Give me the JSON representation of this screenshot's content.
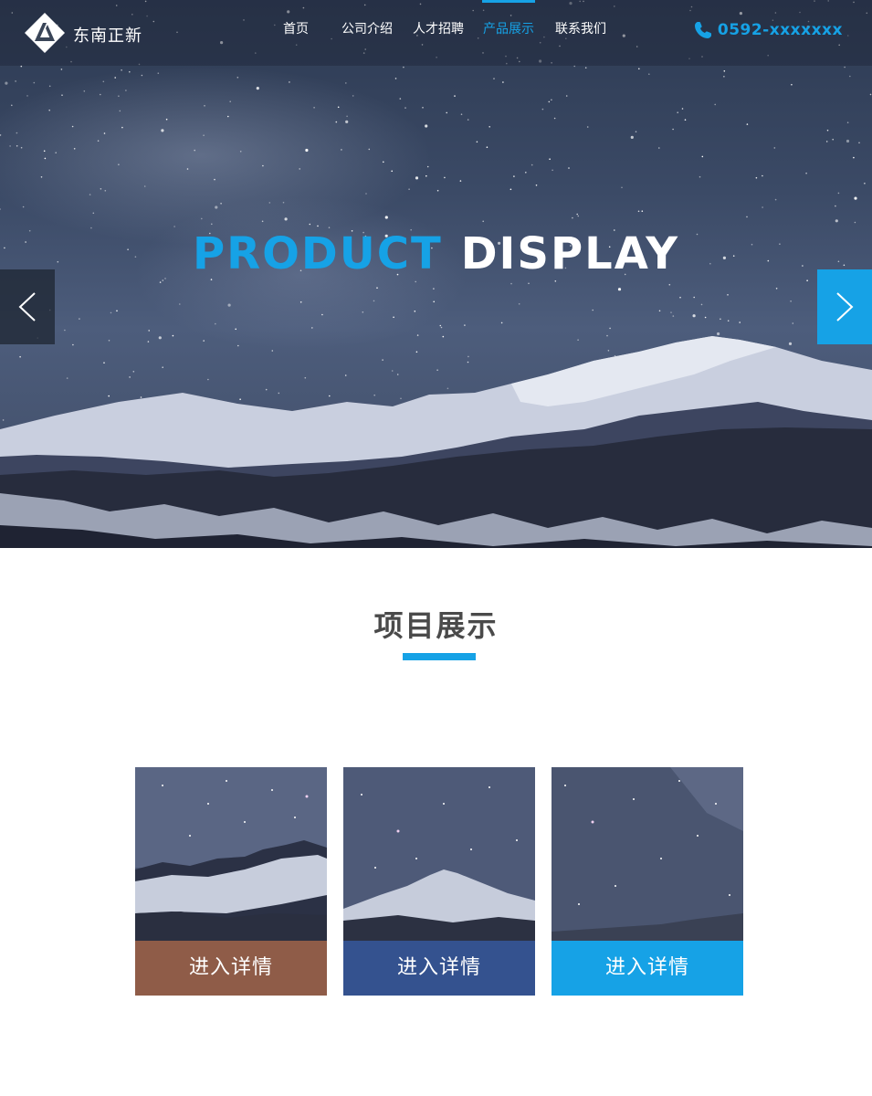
{
  "header": {
    "logo_text": "东南正新",
    "nav": [
      {
        "label": "首页"
      },
      {
        "label": "公司介绍"
      },
      {
        "label": "人才招聘"
      },
      {
        "label": "产品展示",
        "active": true
      },
      {
        "label": "联系我们"
      }
    ],
    "phone": "0592-xxxxxxx",
    "phone_icon": "phone-icon"
  },
  "hero": {
    "title_part1": "PRODUCT",
    "title_part2": "DISPLAY",
    "prev_icon": "chevron-left-icon",
    "next_icon": "chevron-right-icon"
  },
  "section": {
    "title": "项目展示"
  },
  "cards": [
    {
      "button_label": "进入详情",
      "color": "#8f5c48"
    },
    {
      "button_label": "进入详情",
      "color": "#34528f"
    },
    {
      "button_label": "进入详情",
      "color": "#16a2e6"
    }
  ],
  "colors": {
    "accent": "#16a2e6",
    "title_gray": "#4a4a4a"
  }
}
